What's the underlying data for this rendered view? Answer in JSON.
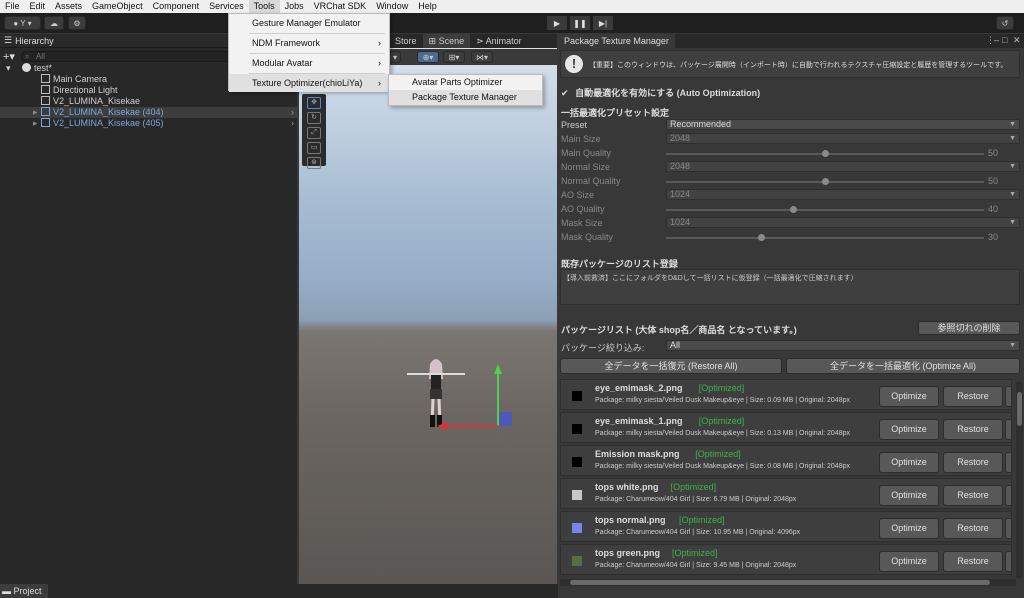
{
  "menubar": {
    "items": [
      "File",
      "Edit",
      "Assets",
      "GameObject",
      "Component",
      "Services",
      "Tools",
      "Jobs",
      "VRChat SDK",
      "Window",
      "Help"
    ]
  },
  "toolbar": {
    "account_label": "Y",
    "account_icon": "account-icon",
    "cloud_icon": "cloud-icon",
    "settings_icon": "gear-icon",
    "play_icon": "▶",
    "pause_icon": "❚❚",
    "step_icon": "▶|",
    "history_icon": "history-icon"
  },
  "tools_menu": {
    "items": [
      {
        "label": "Gesture Manager Emulator",
        "submenu": false
      },
      {
        "label": "NDM Framework",
        "submenu": true
      },
      {
        "label": "Modular Avatar",
        "submenu": true
      },
      {
        "label": "Texture Optimizer(chioLiYa)",
        "submenu": true
      }
    ],
    "sub_items": [
      "Avatar Parts Optimizer",
      "Package Texture Manager"
    ]
  },
  "hierarchy": {
    "tab_title": "Hierarchy",
    "search_placeholder": "All",
    "scene_name": "test*",
    "items": [
      {
        "label": "Main Camera",
        "type": "object"
      },
      {
        "label": "Directional Light",
        "type": "object"
      },
      {
        "label": "V2_LUMINA_Kisekae",
        "type": "object"
      },
      {
        "label": "V2_LUMINA_Kisekae (404)",
        "type": "prefab"
      },
      {
        "label": "V2_LUMINA_Kisekae (405)",
        "type": "prefab"
      }
    ]
  },
  "scene": {
    "tabs": [
      "Store",
      "Scene",
      "Animator"
    ]
  },
  "bottom": {
    "project_tab": "Project"
  },
  "ptm": {
    "title": "Package Texture Manager",
    "notice": "【重要】このウィンドウは、パッケージ展開時（インポート時）に自動で行われるテクスチャ圧縮設定と履歴を管理するツールです。",
    "auto_opt_label": "自動最適化を有効にする (Auto Optimization)",
    "auto_opt_checked": true,
    "preset_section": "一括最適化プリセット設定",
    "preset": {
      "label": "Preset",
      "value": "Recommended"
    },
    "settings": [
      {
        "label": "Main Size",
        "value": "2048"
      },
      {
        "label": "Main Quality",
        "value": "50",
        "level": 0.5
      },
      {
        "label": "Normal Size",
        "value": "2048"
      },
      {
        "label": "Normal Quality",
        "value": "50",
        "level": 0.5
      },
      {
        "label": "AO Size",
        "value": "1024"
      },
      {
        "label": "AO Quality",
        "value": "40",
        "level": 0.4
      },
      {
        "label": "Mask Size",
        "value": "1024"
      },
      {
        "label": "Mask Quality",
        "value": "30",
        "level": 0.3
      }
    ],
    "existing_section": "既存パッケージのリスト登録",
    "existing_hint": "【導入前救済】ここにフォルダをD&Dして一括リストに仮登録（一括最適化で圧縮されます）",
    "list_section": "パッケージリスト (大体 shop名／商品名 となっています。)",
    "remove_broken_label": "参照切れの削除",
    "filter_label": "パッケージ絞り込み:",
    "filter_value": "All",
    "restore_all_label": "全データを一括復元 (Restore All)",
    "optimize_all_label": "全データを一括最適化 (Optimize All)",
    "optimize_label": "Optimize",
    "restore_label": "Restore",
    "packages": [
      {
        "name": "eye_emimask_2.png",
        "status": "[Optimized]",
        "info": "Package: milky siesta/Veiled Dusk Makeup&eye | Size: 0.09 MB | Original: 2048px",
        "thumb": "#000000"
      },
      {
        "name": "eye_emimask_1.png",
        "status": "[Optimized]",
        "info": "Package: milky siesta/Veiled Dusk Makeup&eye | Size: 0.13 MB | Original: 2048px",
        "thumb": "#000000"
      },
      {
        "name": "Emission mask.png",
        "status": "[Optimized]",
        "info": "Package: milky siesta/Veiled Dusk Makeup&eye | Size: 0.08 MB | Original: 2048px",
        "thumb": "#000000"
      },
      {
        "name": "tops white.png",
        "status": "[Optimized]",
        "info": "Package: Charumeow/404 Girl | Size: 6.79 MB | Original: 2048px",
        "thumb": "#c8c8c8"
      },
      {
        "name": "tops normal.png",
        "status": "[Optimized]",
        "info": "Package: Charumeow/404 Girl | Size: 10.95 MB | Original: 4096px",
        "thumb": "#8080f0"
      },
      {
        "name": "tops green.png",
        "status": "[Optimized]",
        "info": "Package: Charumeow/404 Girl | Size: 9.45 MB | Original: 2048px",
        "thumb": "#5a6a4a"
      }
    ]
  }
}
